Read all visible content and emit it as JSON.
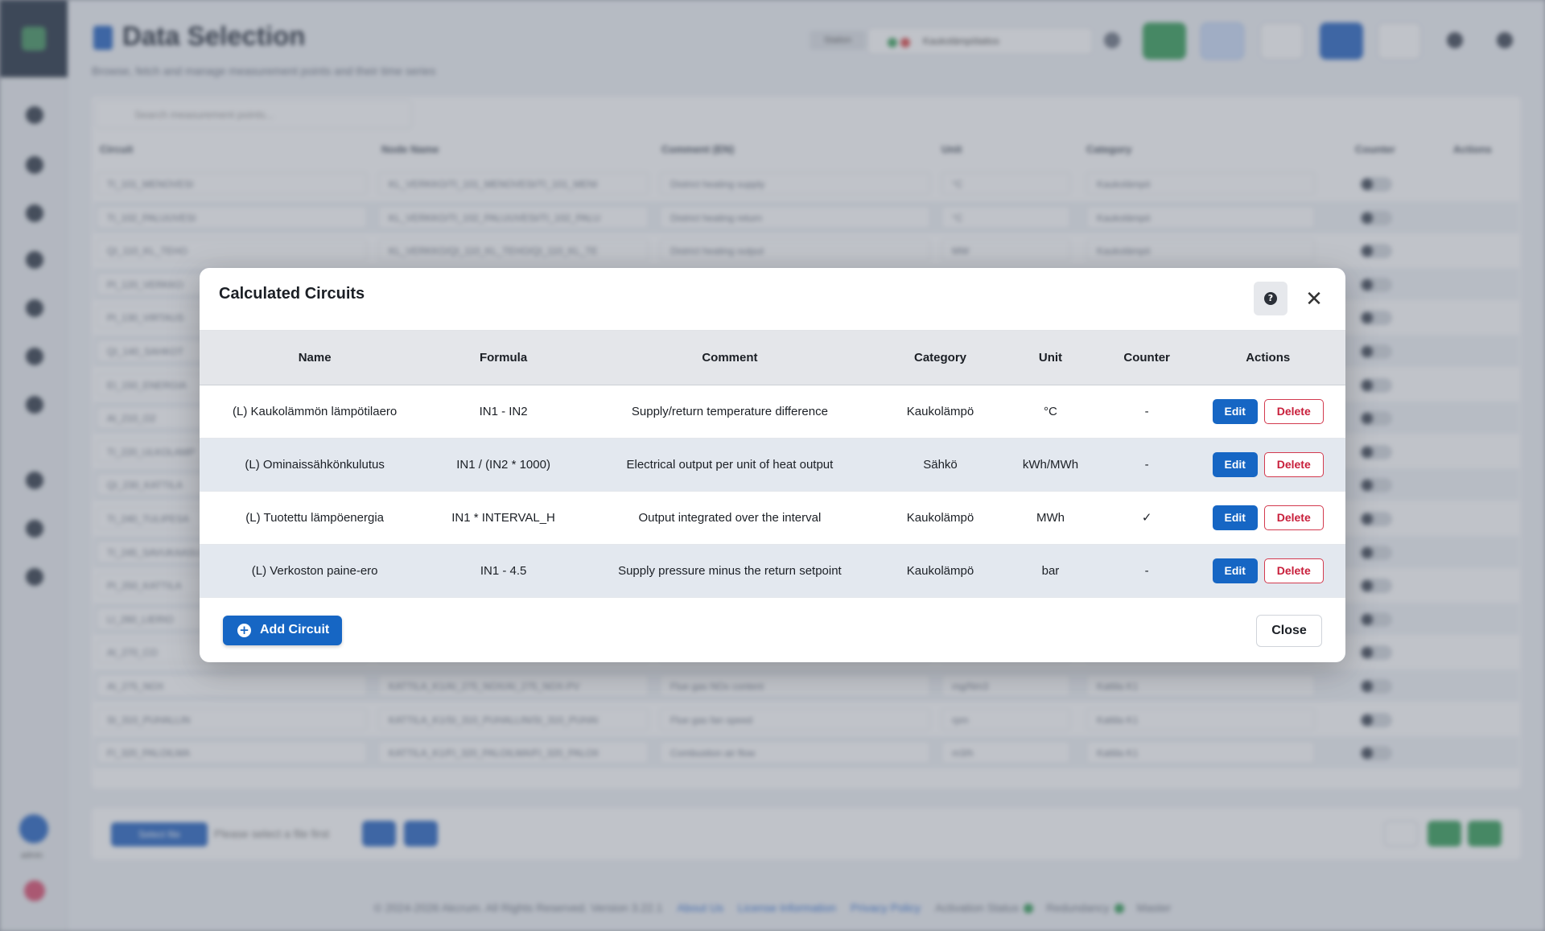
{
  "app": {
    "title": "Data Selection",
    "subtitle": "Browse, fetch and manage measurement points and their time series",
    "station_label": "Station",
    "station_value": "Kaukolämpölaitos",
    "search_placeholder": "Search measurement points..."
  },
  "background_table": {
    "columns": [
      "Circuit",
      "Node Name",
      "Comment (EN)",
      "Unit",
      "Category",
      "Counter",
      "Actions"
    ],
    "rows": [
      {
        "circuit": "TI_101_MENOVESI",
        "node": "KL_VERKKO/TI_101_MENOVESI/TI_101_MENI",
        "comment": "District heating supply",
        "unit": "°C",
        "category": "Kaukolämpö"
      },
      {
        "circuit": "TI_102_PALUUVESI",
        "node": "KL_VERKKO/TI_102_PALUUVESI/TI_102_PALU",
        "comment": "District heating return",
        "unit": "°C",
        "category": "Kaukolämpö"
      },
      {
        "circuit": "QI_110_KL_TEHO",
        "node": "KL_VERKKO/QI_110_KL_TEHO/QI_110_KL_TE",
        "comment": "District heating output",
        "unit": "MW",
        "category": "Kaukolämpö"
      },
      {
        "circuit": "PI_120_VERKKO",
        "node": "",
        "comment": "",
        "unit": "",
        "category": ""
      },
      {
        "circuit": "PI_130_VIRTAUS",
        "node": "",
        "comment": "",
        "unit": "",
        "category": ""
      },
      {
        "circuit": "QI_140_SAHKOT",
        "node": "",
        "comment": "",
        "unit": "",
        "category": ""
      },
      {
        "circuit": "EI_150_ENERGIA",
        "node": "",
        "comment": "",
        "unit": "",
        "category": ""
      },
      {
        "circuit": "AI_210_O2",
        "node": "",
        "comment": "",
        "unit": "",
        "category": ""
      },
      {
        "circuit": "TI_220_ULKOLAMP",
        "node": "",
        "comment": "",
        "unit": "",
        "category": ""
      },
      {
        "circuit": "QI_230_KATTILA",
        "node": "",
        "comment": "",
        "unit": "",
        "category": ""
      },
      {
        "circuit": "TI_240_TULIPESA",
        "node": "",
        "comment": "",
        "unit": "",
        "category": ""
      },
      {
        "circuit": "TI_245_SAVUKAASU",
        "node": "",
        "comment": "",
        "unit": "",
        "category": ""
      },
      {
        "circuit": "PI_250_KATTILA",
        "node": "",
        "comment": "",
        "unit": "",
        "category": ""
      },
      {
        "circuit": "LI_260_LIERIO",
        "node": "",
        "comment": "",
        "unit": "",
        "category": ""
      },
      {
        "circuit": "AI_270_CO",
        "node": "",
        "comment": "",
        "unit": "",
        "category": ""
      },
      {
        "circuit": "AI_275_NOX",
        "node": "KATTILA_K1/AI_275_NOX/AI_275_NOX-PV",
        "comment": "Flue gas NOx content",
        "unit": "mg/Nm3",
        "category": "Kattila K1"
      },
      {
        "circuit": "SI_310_PUHALLIN",
        "node": "KATTILA_K1/SI_310_PUHALLIN/SI_310_PUHAI",
        "comment": "Flue gas fan speed",
        "unit": "rpm",
        "category": "Kattila K1"
      },
      {
        "circuit": "FI_320_PALOILMA",
        "node": "KATTILA_K1/FI_320_PALOILMA/FI_320_PALOII",
        "comment": "Combustion air flow",
        "unit": "m3/h",
        "category": "Kattila K1"
      }
    ]
  },
  "bottom_bar": {
    "select_file_label": "Select file",
    "status_text": "Please select a file first"
  },
  "footer": {
    "copyright": "© 2024-2026 Akcrum. All Rights Reserved. Version 3.22.1",
    "links": [
      "About Us",
      "License Information",
      "Privacy Policy"
    ],
    "activation_label": "Activation Status",
    "redundancy_label": "Redundancy",
    "master_label": "Master"
  },
  "sidebar": {
    "user_label": "admin"
  },
  "modal": {
    "title": "Calculated Circuits",
    "columns": {
      "name": "Name",
      "formula": "Formula",
      "comment": "Comment",
      "category": "Category",
      "unit": "Unit",
      "counter": "Counter",
      "actions": "Actions"
    },
    "rows": [
      {
        "name": "(L) Kaukolämmön lämpötilaero",
        "formula": "IN1 - IN2",
        "comment": "Supply/return temperature difference",
        "category": "Kaukolämpö",
        "unit": "°C",
        "counter": "-",
        "edit": "Edit",
        "delete": "Delete"
      },
      {
        "name": "(L) Ominaissähkönkulutus",
        "formula": "IN1 / (IN2 * 1000)",
        "comment": "Electrical output per unit of heat output",
        "category": "Sähkö",
        "unit": "kWh/MWh",
        "counter": "-",
        "edit": "Edit",
        "delete": "Delete"
      },
      {
        "name": "(L) Tuotettu lämpöenergia",
        "formula": "IN1 * INTERVAL_H",
        "comment": "Output integrated over the interval",
        "category": "Kaukolämpö",
        "unit": "MWh",
        "counter": "✓",
        "edit": "Edit",
        "delete": "Delete"
      },
      {
        "name": "(L) Verkoston paine-ero",
        "formula": "IN1 - 4.5",
        "comment": "Supply pressure minus the return setpoint",
        "category": "Kaukolämpö",
        "unit": "bar",
        "counter": "-",
        "edit": "Edit",
        "delete": "Delete"
      }
    ],
    "add_button": "Add Circuit",
    "close_button": "Close",
    "help_icon_glyph": "?",
    "close_icon_glyph": "✕",
    "plus_icon_glyph": "+"
  },
  "colors": {
    "primary": "#1666c4",
    "danger": "#c81e3a",
    "success": "#2e9a52"
  }
}
